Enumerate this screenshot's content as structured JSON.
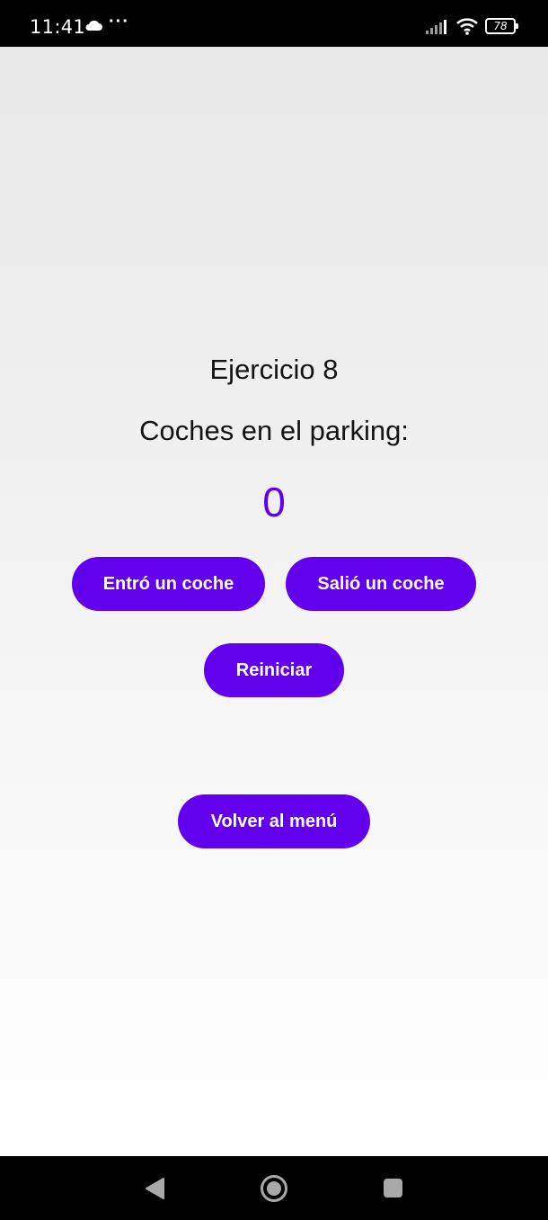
{
  "status_bar": {
    "time": "11:41",
    "more_indicator": "···",
    "battery_level": "78",
    "icons": [
      "cloud-icon",
      "signal-icon",
      "wifi-icon",
      "battery-icon"
    ]
  },
  "screen": {
    "title": "Ejercicio 8",
    "subtitle": "Coches en el parking:",
    "count": "0",
    "buttons": {
      "enter": "Entró un coche",
      "exit": "Salió un coche",
      "reset": "Reiniciar",
      "back": "Volver al menú"
    }
  },
  "nav_bar": {
    "icons": [
      "back-icon",
      "home-icon",
      "recents-icon"
    ]
  },
  "colors": {
    "accent": "#6200ee",
    "text": "#141414",
    "bars": "#000000"
  }
}
